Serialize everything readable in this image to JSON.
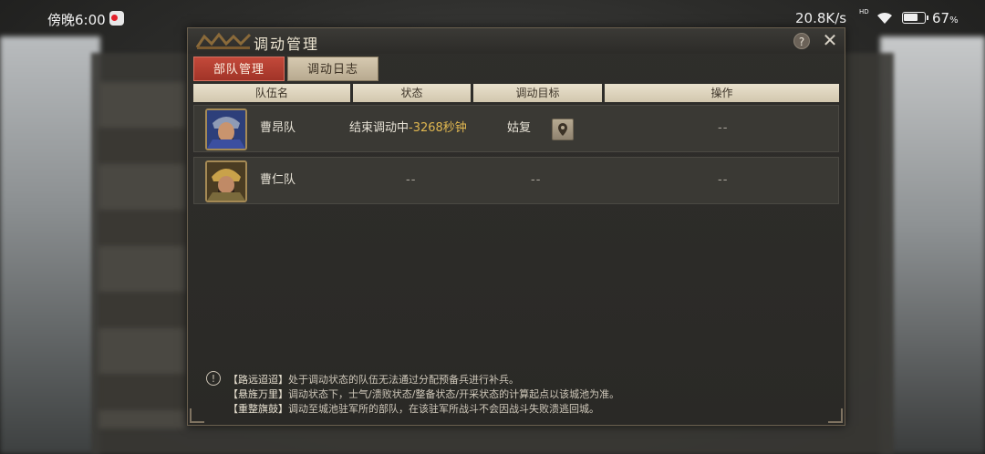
{
  "status_bar": {
    "time": "傍晚6:00",
    "net_speed": "20.8K/s",
    "hd_label": "HD",
    "battery_percent": "67",
    "battery_unit": "%"
  },
  "dialog": {
    "title": "调动管理",
    "help_label": "?",
    "close_label": "✕",
    "tabs": [
      {
        "label": "部队管理",
        "active": true
      },
      {
        "label": "调动日志",
        "active": false
      }
    ],
    "columns": [
      "队伍名",
      "状态",
      "调动目标",
      "操作"
    ],
    "rows": [
      {
        "name": "曹昂队",
        "status_prefix": "结束调动中",
        "status_countdown": "-3268秒钟",
        "target": "姑复",
        "action": "--",
        "avatar_icon": "general-portrait-blue"
      },
      {
        "name": "曹仁队",
        "status": "--",
        "target": "--",
        "action": "--",
        "avatar_icon": "general-portrait-gold"
      }
    ],
    "notes": [
      {
        "key": "【路远迢迢】",
        "text": "处于调动状态的队伍无法通过分配预备兵进行补兵。"
      },
      {
        "key": "【悬旌万里】",
        "text": "调动状态下，士气/溃败状态/整备状态/开采状态的计算起点以该城池为准。"
      },
      {
        "key": "【重整旗鼓】",
        "text": "调动至城池驻军所的部队，在该驻军所战斗不会因战斗失败溃逃回城。"
      }
    ],
    "info_icon": "!"
  },
  "colors": {
    "accent_red": "#b13d30",
    "countdown_yellow": "#e0b750",
    "header_beige": "#e0d7c1"
  }
}
